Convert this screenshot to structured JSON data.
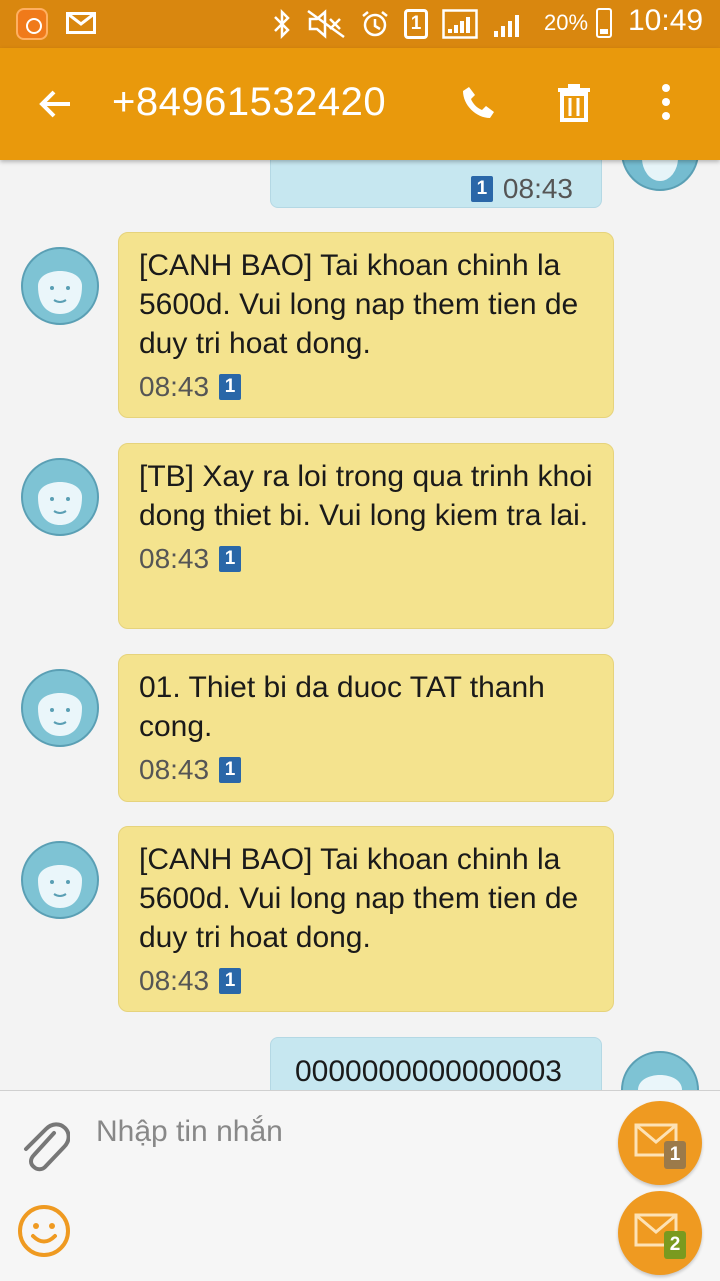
{
  "statusbar": {
    "sim_label": "1",
    "battery": "20%",
    "time": "10:49",
    "icons": [
      "app-notification-icon",
      "mail-icon",
      "bluetooth-icon",
      "mute-icon",
      "alarm-icon",
      "sim-icon",
      "signal-icon",
      "signal-icon",
      "battery-charging-icon"
    ]
  },
  "header": {
    "title": "+84961532420",
    "icons": [
      "back-arrow-icon",
      "phone-icon",
      "trash-icon",
      "more-vert-icon"
    ]
  },
  "messages": [
    {
      "direction": "out",
      "text": "",
      "time": "08:43",
      "sim": "1"
    },
    {
      "direction": "in",
      "text": "[CANH BAO] Tai khoan chinh la 5600d. Vui long nap them tien de duy tri hoat dong.",
      "time": "08:43",
      "sim": "1"
    },
    {
      "direction": "in",
      "text": "[TB] Xay ra loi trong qua trinh khoi dong thiet bi. Vui long kiem tra lai.",
      "time": "08:43",
      "sim": "1"
    },
    {
      "direction": "in",
      "text": "01. Thiet bi da duoc TAT thanh cong.",
      "time": "08:43",
      "sim": "1"
    },
    {
      "direction": "in",
      "text": "[CANH BAO] Tai khoan chinh la 5600d. Vui long nap them tien de duy tri hoat dong.",
      "time": "08:43",
      "sim": "1"
    },
    {
      "direction": "out",
      "text": "0000000000000003",
      "time": "",
      "sim": ""
    }
  ],
  "composer": {
    "placeholder": "Nhập tin nhắn",
    "send_sim1": "1",
    "send_sim2": "2"
  },
  "colors": {
    "statusbar": "#d9870f",
    "appbar": "#e9990c",
    "incoming_bubble": "#f4e38e",
    "outgoing_bubble": "#c6e7f0",
    "send_button": "#ef9a21",
    "sim1_badge": "#2a67a8",
    "sim2_badge": "#7a9a1f"
  }
}
